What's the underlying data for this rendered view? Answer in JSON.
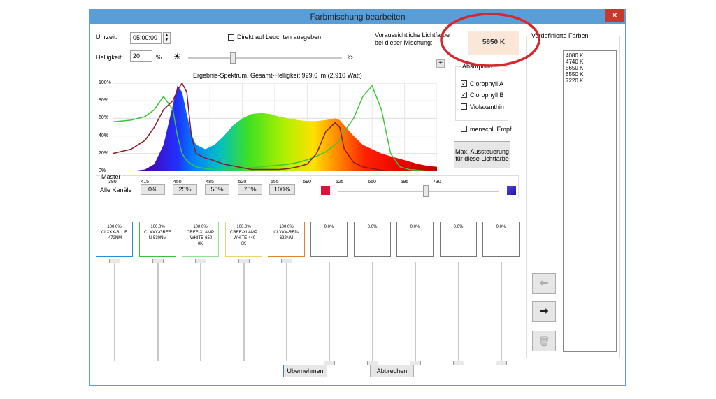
{
  "window": {
    "title": "Farbmischung bearbeiten",
    "close_glyph": "✕"
  },
  "time": {
    "label": "Uhrzeit:",
    "value": "05:00:00"
  },
  "direct_output": {
    "label": "Direkt auf Leuchten ausgeben",
    "checked": false
  },
  "expected": {
    "label_line1": "Voraussichtliche Lichtfarbe",
    "label_line2": "bei dieser Mischung:",
    "value": "5650 K"
  },
  "brightness": {
    "label": "Helligkeit:",
    "value": "20",
    "unit": "%",
    "slider_fraction": 0.2
  },
  "plus_button": "+",
  "absorption": {
    "title": "Absorption",
    "items": [
      {
        "label": "Clorophyll A",
        "checked": true
      },
      {
        "label": "Clorophyll B",
        "checked": true
      },
      {
        "label": "Violaxanthin",
        "checked": false
      }
    ]
  },
  "human_sensitivity": {
    "label": "menschl. Empf.",
    "checked": false
  },
  "max_button": {
    "line1": "Max. Aussteuerung",
    "line2": "für diese Lichtfarbe"
  },
  "predefined": {
    "title": "Vordefinierte Farben",
    "items": [
      "4080 K",
      "4740 K",
      "5650 K",
      "6550 K",
      "7220 K"
    ]
  },
  "chart_data": {
    "type": "area",
    "title": "Ergebnis-Spektrum, Gesamt-Helligkeit 929,6 lm (2,910 Watt)",
    "xlabel": "",
    "ylabel": "",
    "xlim": [
      380,
      730
    ],
    "ylim": [
      0,
      100
    ],
    "x_ticks": [
      "380",
      "415",
      "450",
      "485",
      "520",
      "555",
      "590",
      "625",
      "660",
      "695",
      "730"
    ],
    "y_ticks": [
      "100%",
      "80%",
      "60%",
      "40%",
      "20%",
      "0%"
    ],
    "grid": true,
    "x": [
      380,
      400,
      415,
      425,
      435,
      445,
      450,
      455,
      460,
      465,
      470,
      480,
      490,
      500,
      510,
      520,
      530,
      540,
      550,
      560,
      570,
      580,
      590,
      600,
      610,
      620,
      625,
      630,
      640,
      650,
      660,
      670,
      680,
      690,
      700,
      710,
      720,
      730
    ],
    "series": [
      {
        "values": [
          0,
          0,
          2,
          8,
          30,
          75,
          97,
          90,
          65,
          42,
          30,
          25,
          30,
          40,
          52,
          60,
          65,
          66,
          65,
          62,
          60,
          58,
          57,
          57,
          58,
          60,
          58,
          52,
          40,
          30,
          25,
          20,
          17,
          14,
          11,
          8,
          6,
          5
        ]
      },
      {
        "values": [
          56,
          58,
          62,
          70,
          85,
          70,
          40,
          20,
          12,
          8,
          5,
          3,
          2,
          2,
          2,
          3,
          4,
          5,
          6,
          7,
          8,
          10,
          13,
          17,
          22,
          30,
          35,
          45,
          60,
          85,
          97,
          70,
          20,
          5,
          2,
          1,
          0,
          0
        ]
      },
      {
        "values": [
          20,
          25,
          35,
          50,
          70,
          80,
          92,
          100,
          90,
          40,
          20,
          15,
          12,
          8,
          6,
          4,
          2,
          2,
          2,
          2,
          3,
          5,
          8,
          20,
          45,
          55,
          50,
          25,
          10,
          5,
          3,
          1,
          0,
          0,
          0,
          0,
          0,
          0
        ]
      }
    ]
  },
  "master": {
    "title": "Master",
    "label": "Alle Kanäle",
    "presets": [
      "0%",
      "25%",
      "50%",
      "75%",
      "100%"
    ],
    "slider_fraction": 0.5
  },
  "channels": [
    {
      "value": "100,0%",
      "name_lines": [
        "CLXXX-BLUE",
        "-472NM"
      ],
      "color": "#1e90e0",
      "fraction": 1.0
    },
    {
      "value": "100,0%",
      "name_lines": [
        "CLXXX-GREE",
        "N-530NM"
      ],
      "color": "#40c040",
      "fraction": 1.0
    },
    {
      "value": "100,0%",
      "name_lines": [
        "CREE-XLAMP",
        "-WHITE-650",
        "0K"
      ],
      "color": "#90e090",
      "fraction": 1.0
    },
    {
      "value": "100,0%",
      "name_lines": [
        "CREE-XLAMP",
        "-WHITE-440",
        "0K"
      ],
      "color": "#f0d070",
      "fraction": 1.0
    },
    {
      "value": "100,0%",
      "name_lines": [
        "CLXXX-RED-",
        "622NM"
      ],
      "color": "#e08030",
      "fraction": 1.0
    },
    {
      "value": "0,0%",
      "name_lines": [],
      "color": "#777777",
      "fraction": 0.0
    },
    {
      "value": "0,0%",
      "name_lines": [],
      "color": "#777777",
      "fraction": 0.0
    },
    {
      "value": "0,0%",
      "name_lines": [],
      "color": "#777777",
      "fraction": 0.0
    },
    {
      "value": "0,0%",
      "name_lines": [],
      "color": "#777777",
      "fraction": 0.0
    },
    {
      "value": "0,0%",
      "name_lines": [],
      "color": "#777777",
      "fraction": 0.0
    }
  ],
  "icons": {
    "sun_small": "sun-icon",
    "sun_large": "sun-bright-icon",
    "arrow_left": "arrow-left-icon",
    "arrow_right": "arrow-right-icon",
    "trash": "trash-icon"
  },
  "footer": {
    "apply": "Übernehmen",
    "cancel": "Abbrechen"
  },
  "colors": {
    "title_bar": "#5a9ed8",
    "close": "#c7392b",
    "highlight": "#fbe7d8",
    "annotation": "#d9262c"
  }
}
